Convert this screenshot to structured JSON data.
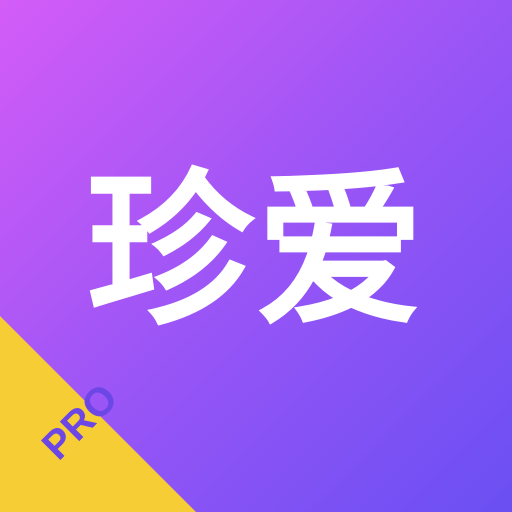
{
  "app_icon": {
    "logo_text": "珍爱",
    "badge_text": "PRO",
    "colors": {
      "gradient_start": "#d45cf7",
      "gradient_mid": "#9a55f6",
      "gradient_end": "#6a4ff3",
      "ribbon": "#f6cd35",
      "badge_text_color": "#6d46e6",
      "logo_text_color": "#ffffff"
    }
  }
}
